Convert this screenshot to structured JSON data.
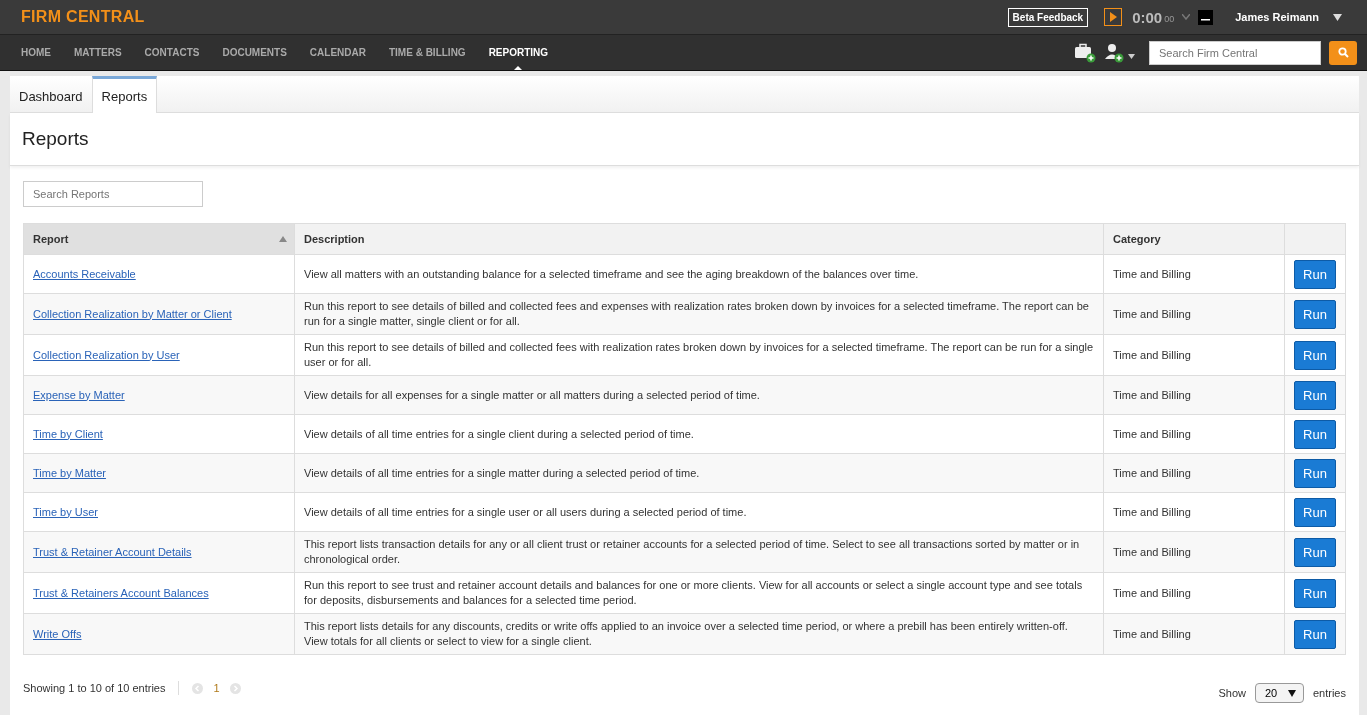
{
  "brand": "FIRM CENTRAL",
  "topbar": {
    "feedback_button": "Beta Feedback",
    "timer": "0:00",
    "timer_seconds": "00",
    "user": "James Reimann"
  },
  "nav": [
    {
      "label": "HOME",
      "selected": false
    },
    {
      "label": "MATTERS",
      "selected": false
    },
    {
      "label": "CONTACTS",
      "selected": false
    },
    {
      "label": "DOCUMENTS",
      "selected": false
    },
    {
      "label": "CALENDAR",
      "selected": false
    },
    {
      "label": "TIME & BILLING",
      "selected": false
    },
    {
      "label": "REPORTING",
      "selected": true
    }
  ],
  "search": {
    "placeholder": "Search Firm Central"
  },
  "tabs": [
    {
      "label": "Dashboard",
      "selected": false
    },
    {
      "label": "Reports",
      "selected": true
    }
  ],
  "page_title": "Reports",
  "report_search": {
    "placeholder": "Search Reports"
  },
  "table": {
    "columns": [
      "Report",
      "Description",
      "Category"
    ],
    "rows": [
      {
        "report": "Accounts Receivable",
        "description": "View all matters with an outstanding balance for a selected timeframe and see the aging breakdown of the balances over time.",
        "category": "Time and Billing",
        "action": "Run"
      },
      {
        "report": "Collection Realization by Matter or Client",
        "description": "Run this report to see details of billed and collected fees and expenses with realization rates broken down by invoices for a selected timeframe. The report can be run for a single matter, single client or for all.",
        "category": "Time and Billing",
        "action": "Run"
      },
      {
        "report": "Collection Realization by User",
        "description": "Run this report to see details of billed and collected fees with realization rates broken down by invoices for a selected timeframe. The report can be run for a single user or for all.",
        "category": "Time and Billing",
        "action": "Run"
      },
      {
        "report": "Expense by Matter",
        "description": "View details for all expenses for a single matter or all matters during a selected period of time.",
        "category": "Time and Billing",
        "action": "Run"
      },
      {
        "report": "Time by Client",
        "description": "View details of all time entries for a single client during a selected period of time.",
        "category": "Time and Billing",
        "action": "Run"
      },
      {
        "report": "Time by Matter",
        "description": "View details of all time entries for a single matter during a selected period of time.",
        "category": "Time and Billing",
        "action": "Run"
      },
      {
        "report": "Time by User",
        "description": "View details of all time entries for a single user or all users during a selected period of time.",
        "category": "Time and Billing",
        "action": "Run"
      },
      {
        "report": "Trust & Retainer Account Details",
        "description": "This report lists transaction details for any or all client trust or retainer accounts for a selected period of time. Select to see all transactions sorted by matter or in chronological order.",
        "category": "Time and Billing",
        "action": "Run"
      },
      {
        "report": "Trust & Retainers Account Balances",
        "description": "Run this report to see trust and retainer account details and balances for one or more clients. View for all accounts or select a single account type and see totals for deposits, disbursements and balances for a selected time period.",
        "category": "Time and Billing",
        "action": "Run"
      },
      {
        "report": "Write Offs",
        "description": "This report lists details for any discounts, credits or write offs applied to an invoice over a selected time period, or where a prebill has been entirely written-off. View totals for all clients or select to view for a single client.",
        "category": "Time and Billing",
        "action": "Run"
      }
    ]
  },
  "footer": {
    "summary": "Showing 1 to 10 of 10 entries",
    "current_page": "1",
    "show_label": "Show",
    "page_size": "20",
    "entries_label": "entries"
  }
}
